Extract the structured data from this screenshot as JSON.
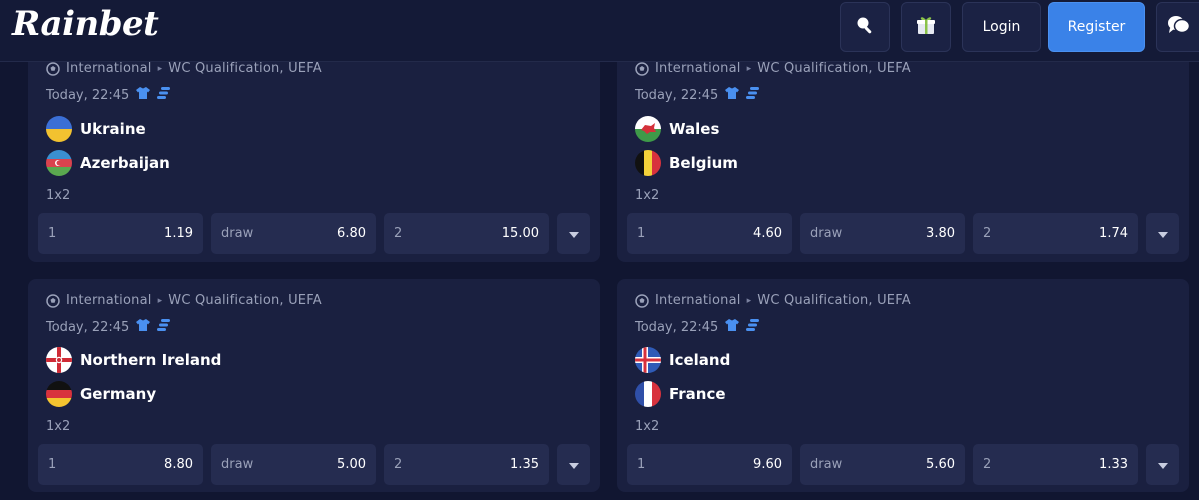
{
  "header": {
    "logo": "Rainbet",
    "login_label": "Login",
    "register_label": "Register",
    "icons": [
      "search-icon",
      "gift-icon",
      "chat-icon"
    ]
  },
  "matches": [
    {
      "league_prefix": "International",
      "league": "WC Qualification, UEFA",
      "time": "Today, 22:45",
      "team1": {
        "name": "Ukraine",
        "flag": "ukraine"
      },
      "team2": {
        "name": "Azerbaijan",
        "flag": "azerbaijan"
      },
      "market": "1x2",
      "odds": [
        {
          "label": "1",
          "value": "1.19"
        },
        {
          "label": "draw",
          "value": "6.80"
        },
        {
          "label": "2",
          "value": "15.00"
        }
      ]
    },
    {
      "league_prefix": "International",
      "league": "WC Qualification, UEFA",
      "time": "Today, 22:45",
      "team1": {
        "name": "Wales",
        "flag": "wales"
      },
      "team2": {
        "name": "Belgium",
        "flag": "belgium"
      },
      "market": "1x2",
      "odds": [
        {
          "label": "1",
          "value": "4.60"
        },
        {
          "label": "draw",
          "value": "3.80"
        },
        {
          "label": "2",
          "value": "1.74"
        }
      ]
    },
    {
      "league_prefix": "International",
      "league": "WC Qualification, UEFA",
      "time": "Today, 22:45",
      "team1": {
        "name": "Northern Ireland",
        "flag": "northern-ireland"
      },
      "team2": {
        "name": "Germany",
        "flag": "germany"
      },
      "market": "1x2",
      "odds": [
        {
          "label": "1",
          "value": "8.80"
        },
        {
          "label": "draw",
          "value": "5.00"
        },
        {
          "label": "2",
          "value": "1.35"
        }
      ]
    },
    {
      "league_prefix": "International",
      "league": "WC Qualification, UEFA",
      "time": "Today, 22:45",
      "team1": {
        "name": "Iceland",
        "flag": "iceland"
      },
      "team2": {
        "name": "France",
        "flag": "france"
      },
      "market": "1x2",
      "odds": [
        {
          "label": "1",
          "value": "9.60"
        },
        {
          "label": "draw",
          "value": "5.60"
        },
        {
          "label": "2",
          "value": "1.33"
        }
      ]
    }
  ],
  "colors": {
    "background": "#111631",
    "card": "#1a2040",
    "odd_button": "#252c50",
    "register": "#3a82e8",
    "muted_text": "#9aa1b9",
    "accent_icon": "#4a90f0"
  }
}
